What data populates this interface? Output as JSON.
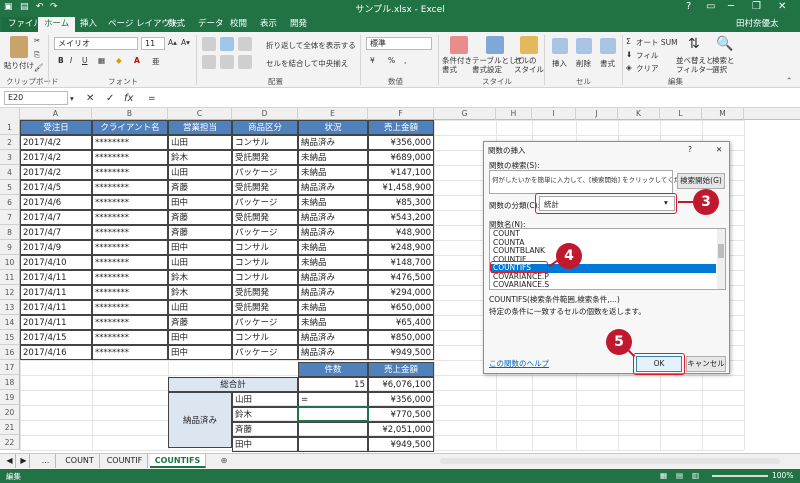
{
  "window": {
    "title": "サンプル.xlsx - Excel",
    "minimize": "─",
    "restore": "❐",
    "close": "✕",
    "help": "?",
    "ribbon_display": "▭"
  },
  "ribbon": {
    "tabs": [
      "ファイル",
      "ホーム",
      "挿入",
      "ページ レイアウト",
      "数式",
      "データ",
      "校閲",
      "表示",
      "開発"
    ],
    "user": "田村奈優太",
    "clipboard": {
      "paste": "貼り付け",
      "label": "クリップボード"
    },
    "font": {
      "name": "メイリオ",
      "size": "11",
      "label": "フォント",
      "grow": "A▴",
      "shrink": "A▾",
      "bold": "B",
      "italic": "I",
      "underline": "U",
      "color_a": "A",
      "phonetic": "亜"
    },
    "alignment": {
      "wrap": "折り返して全体を表示する",
      "merge": "セルを結合して中央揃え",
      "label": "配置"
    },
    "number": {
      "format": "標準",
      "percent": "%",
      "comma": ",",
      "label": "数値"
    },
    "styles": {
      "conditional": "条件付き\n書式",
      "table": "テーブルとして\n書式設定",
      "cell": "セルの\nスタイル",
      "label": "スタイル"
    },
    "cells": {
      "insert": "挿入",
      "delete": "削除",
      "format": "書式",
      "label": "セル"
    },
    "editing": {
      "autosum": "オート SUM",
      "fill": "フィル",
      "clear": "クリア",
      "sort": "並べ替えと\nフィルター",
      "find": "検索と\n選択",
      "label": "編集"
    }
  },
  "formula_bar": {
    "name_box": "E20",
    "cancel": "✕",
    "enter": "✓",
    "fx": "fx",
    "value": "="
  },
  "columns": [
    "A",
    "B",
    "C",
    "D",
    "E",
    "F",
    "G",
    "H",
    "I",
    "J",
    "K",
    "L",
    "M"
  ],
  "table": {
    "headers": [
      "受注日",
      "クライアント名",
      "営業担当",
      "商品区分",
      "状況",
      "売上金額"
    ],
    "rows": [
      [
        "2017/4/2",
        "********",
        "山田",
        "コンサル",
        "納品済み",
        "¥356,000"
      ],
      [
        "2017/4/2",
        "********",
        "鈴木",
        "受託開発",
        "未納品",
        "¥689,000"
      ],
      [
        "2017/4/2",
        "********",
        "山田",
        "パッケージ",
        "未納品",
        "¥147,100"
      ],
      [
        "2017/4/5",
        "********",
        "斉藤",
        "受託開発",
        "納品済み",
        "¥1,458,900"
      ],
      [
        "2017/4/6",
        "********",
        "田中",
        "パッケージ",
        "未納品",
        "¥85,300"
      ],
      [
        "2017/4/7",
        "********",
        "斉藤",
        "受託開発",
        "納品済み",
        "¥543,200"
      ],
      [
        "2017/4/7",
        "********",
        "斉藤",
        "パッケージ",
        "納品済み",
        "¥48,900"
      ],
      [
        "2017/4/9",
        "********",
        "田中",
        "コンサル",
        "未納品",
        "¥248,900"
      ],
      [
        "2017/4/10",
        "********",
        "山田",
        "コンサル",
        "未納品",
        "¥148,700"
      ],
      [
        "2017/4/11",
        "********",
        "鈴木",
        "コンサル",
        "納品済み",
        "¥476,500"
      ],
      [
        "2017/4/11",
        "********",
        "鈴木",
        "受託開発",
        "納品済み",
        "¥294,000"
      ],
      [
        "2017/4/11",
        "********",
        "山田",
        "受託開発",
        "未納品",
        "¥650,000"
      ],
      [
        "2017/4/11",
        "********",
        "斉藤",
        "パッケージ",
        "未納品",
        "¥65,400"
      ],
      [
        "2017/4/15",
        "********",
        "田中",
        "コンサル",
        "納品済み",
        "¥850,000"
      ],
      [
        "2017/4/16",
        "********",
        "田中",
        "パッケージ",
        "納品済み",
        "¥949,500"
      ]
    ]
  },
  "summary": {
    "hdr_count": "件数",
    "hdr_sales": "売上金額",
    "total_label": "総合計",
    "total_count": "15",
    "total_sales": "¥6,076,100",
    "group_label": "納品済み",
    "rows": [
      [
        "山田",
        "=",
        "¥356,000"
      ],
      [
        "鈴木",
        "",
        "¥770,500"
      ],
      [
        "斉藤",
        "",
        "¥2,051,000"
      ],
      [
        "田中",
        "",
        "¥949,500"
      ]
    ]
  },
  "dialog": {
    "title": "関数の挿入",
    "help": "?",
    "close": "✕",
    "search_label": "関数の検索(S):",
    "search_placeholder": "何がしたいかを簡単に入力して、[検索開始] をクリックしてください。",
    "search_button": "検索開始(G)",
    "category_label": "関数の分類(C):",
    "category_value": "統計",
    "name_label": "関数名(N):",
    "functions": [
      "COUNT",
      "COUNTA",
      "COUNTBLANK",
      "COUNTIF",
      "COUNTIFS",
      "COVARIANCE.P",
      "COVARIANCE.S"
    ],
    "selected_function": "COUNTIFS",
    "syntax": "COUNTIFS(検索条件範囲,検索条件,...)",
    "description": "特定の条件に一致するセルの個数を返します。",
    "help_link": "この関数のヘルプ",
    "ok": "OK",
    "cancel": "キャンセル"
  },
  "callouts": [
    "3",
    "4",
    "5"
  ],
  "sheets": {
    "nav_prev": "◀",
    "nav_next": "▶",
    "more": "...",
    "tabs": [
      "COUNT",
      "COUNTIF",
      "COUNTIFS"
    ],
    "active": "COUNTIFS",
    "add": "⊕"
  },
  "status": {
    "mode": "編集",
    "zoom": "100%"
  },
  "colors": {
    "excel_green": "#217346",
    "header_blue": "#4f81bd",
    "summary_blue": "#dce6f1",
    "callout_red": "#c0192d",
    "selection_blue": "#0078d7"
  }
}
